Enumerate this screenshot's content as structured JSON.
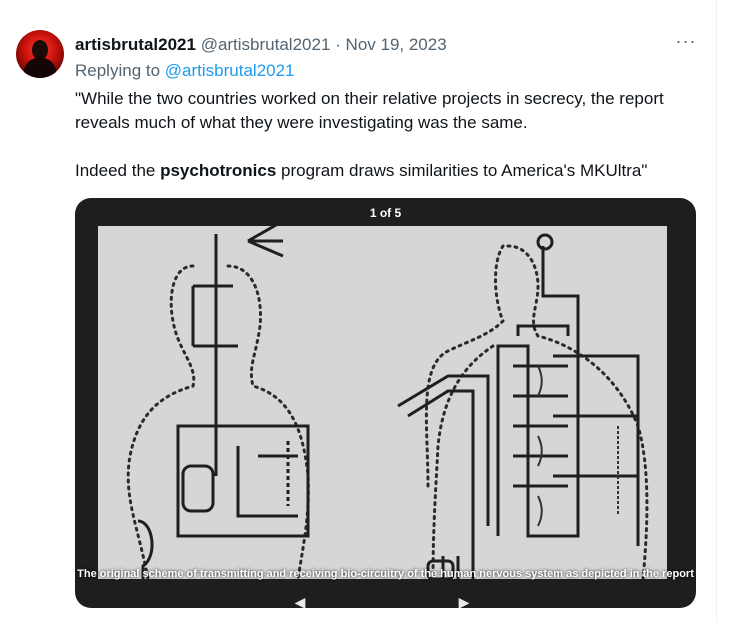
{
  "tweet": {
    "display_name": "artisbrutal2021",
    "handle": "@artisbrutal2021",
    "separator": "·",
    "date": "Nov 19, 2023",
    "more_label": "···",
    "replying_prefix": "Replying to",
    "replying_handle": "@artisbrutal2021",
    "text_p1": "\"While the two countries worked on  their relative projects in secrecy, the report reveals much of what they  were investigating was the same.",
    "text_p2_before": "Indeed the ",
    "text_p2_bold": "psychotronics",
    "text_p2_after": " program draws similarities to America's MKUltra\""
  },
  "media": {
    "counter": "1 of 5",
    "caption": "The original scheme of transmitting and receiving bio-circuitry of the human nervous system as depicted in the report",
    "prev_icon": "arrow-left-icon",
    "next_icon": "arrow-right-icon"
  },
  "colors": {
    "link": "#1d9bf0",
    "muted": "#536471",
    "text": "#0f1419",
    "media_bg": "#1e1e1e"
  }
}
